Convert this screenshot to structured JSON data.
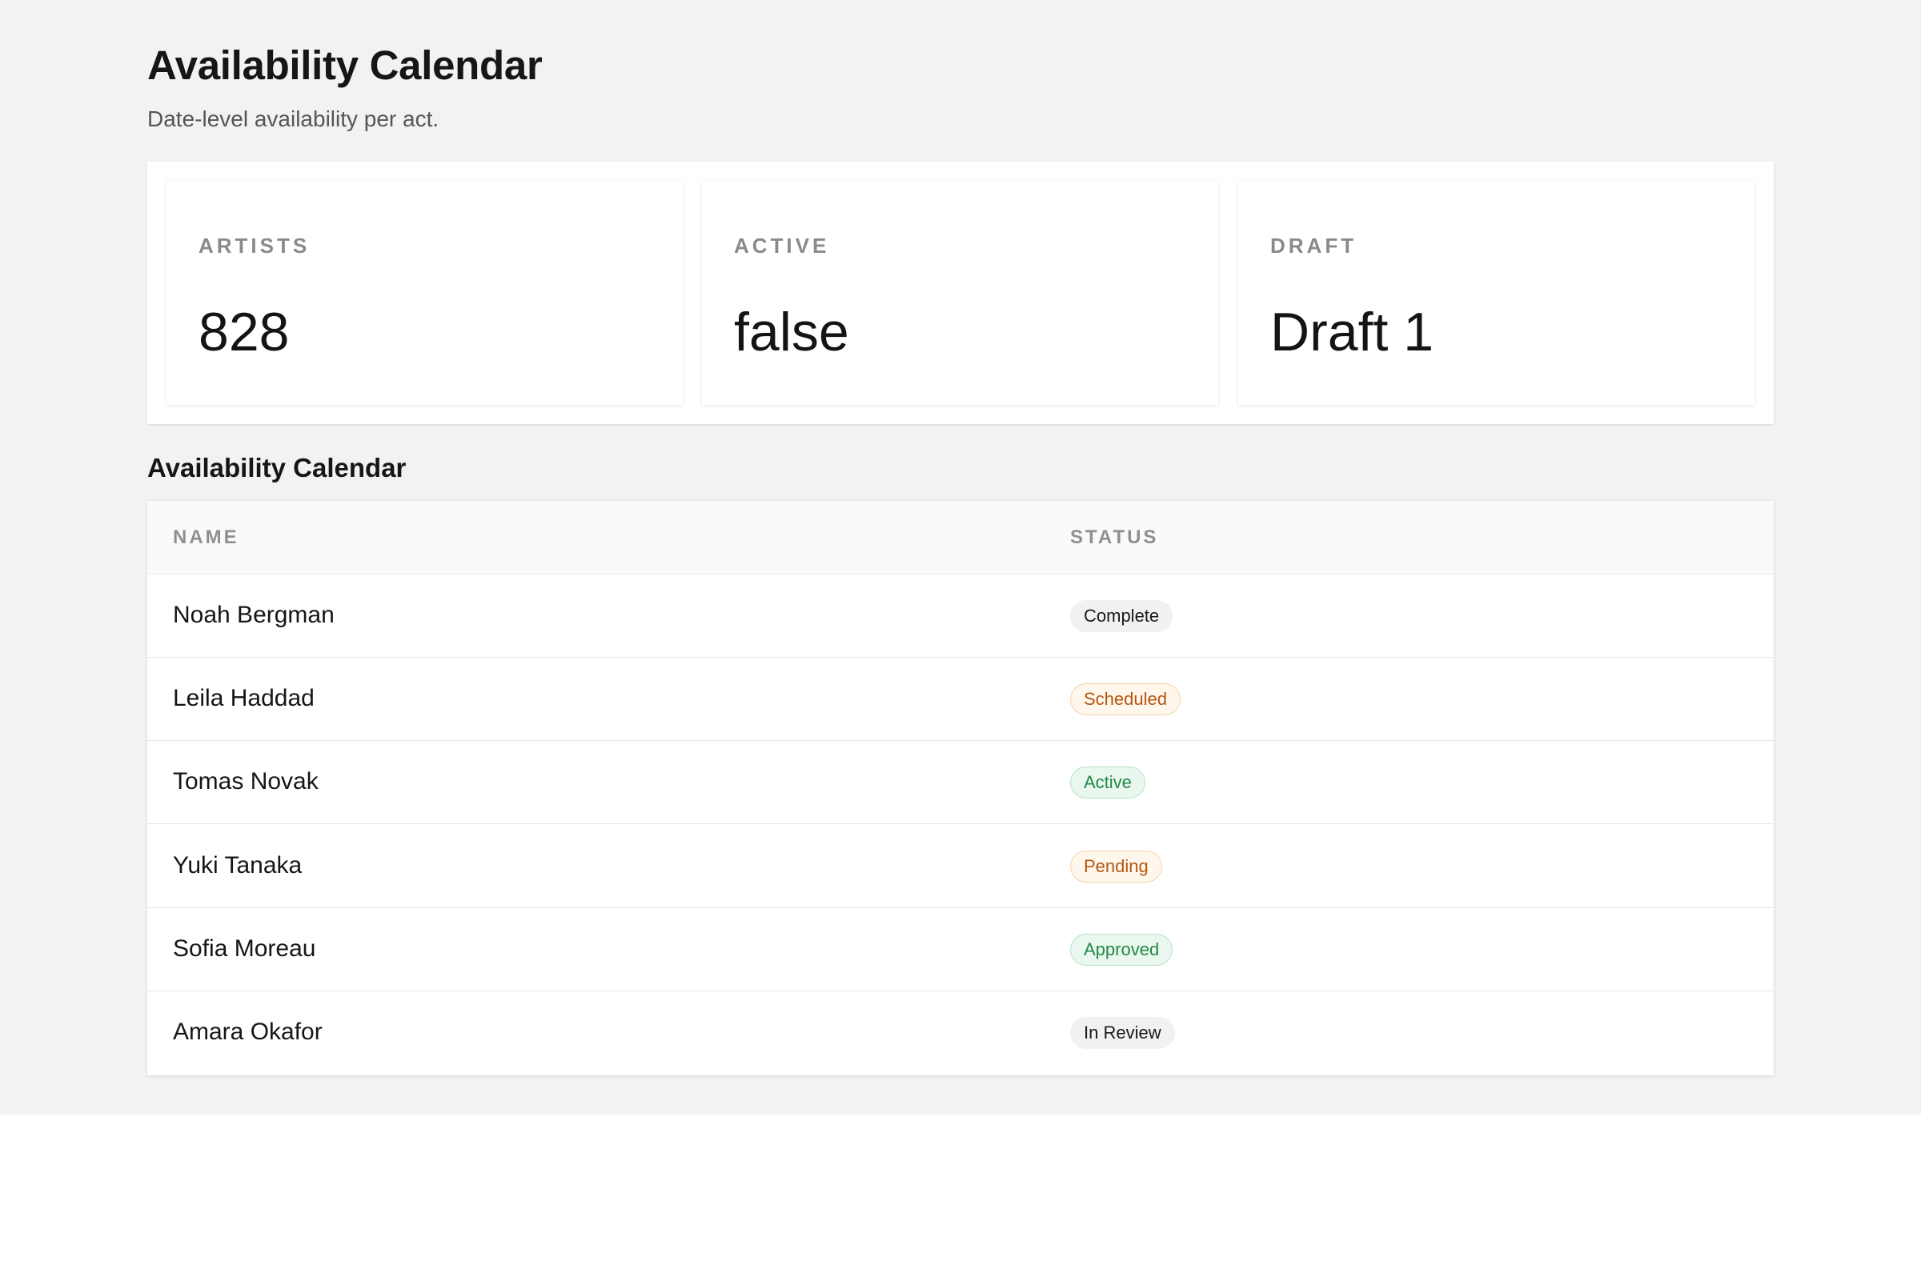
{
  "header": {
    "title": "Availability Calendar",
    "subtitle": "Date-level availability per act."
  },
  "stats": [
    {
      "label": "ARTISTS",
      "value": "828"
    },
    {
      "label": "ACTIVE",
      "value": "false"
    },
    {
      "label": "DRAFT",
      "value": "Draft 1"
    }
  ],
  "table": {
    "title": "Availability Calendar",
    "columns": [
      "NAME",
      "STATUS"
    ],
    "rows": [
      {
        "name": "Noah Bergman",
        "status": "Complete",
        "tone": "neutral"
      },
      {
        "name": "Leila Haddad",
        "status": "Scheduled",
        "tone": "warning"
      },
      {
        "name": "Tomas Novak",
        "status": "Active",
        "tone": "success"
      },
      {
        "name": "Yuki Tanaka",
        "status": "Pending",
        "tone": "warning"
      },
      {
        "name": "Sofia Moreau",
        "status": "Approved",
        "tone": "success"
      },
      {
        "name": "Amara Okafor",
        "status": "In Review",
        "tone": "neutral"
      }
    ]
  },
  "colors": {
    "page_background": "#f2f2f2",
    "card_background": "#ffffff",
    "badge_neutral": "#f1f1f1",
    "badge_warning_text": "#b4560f",
    "badge_success_text": "#1f8a45"
  }
}
